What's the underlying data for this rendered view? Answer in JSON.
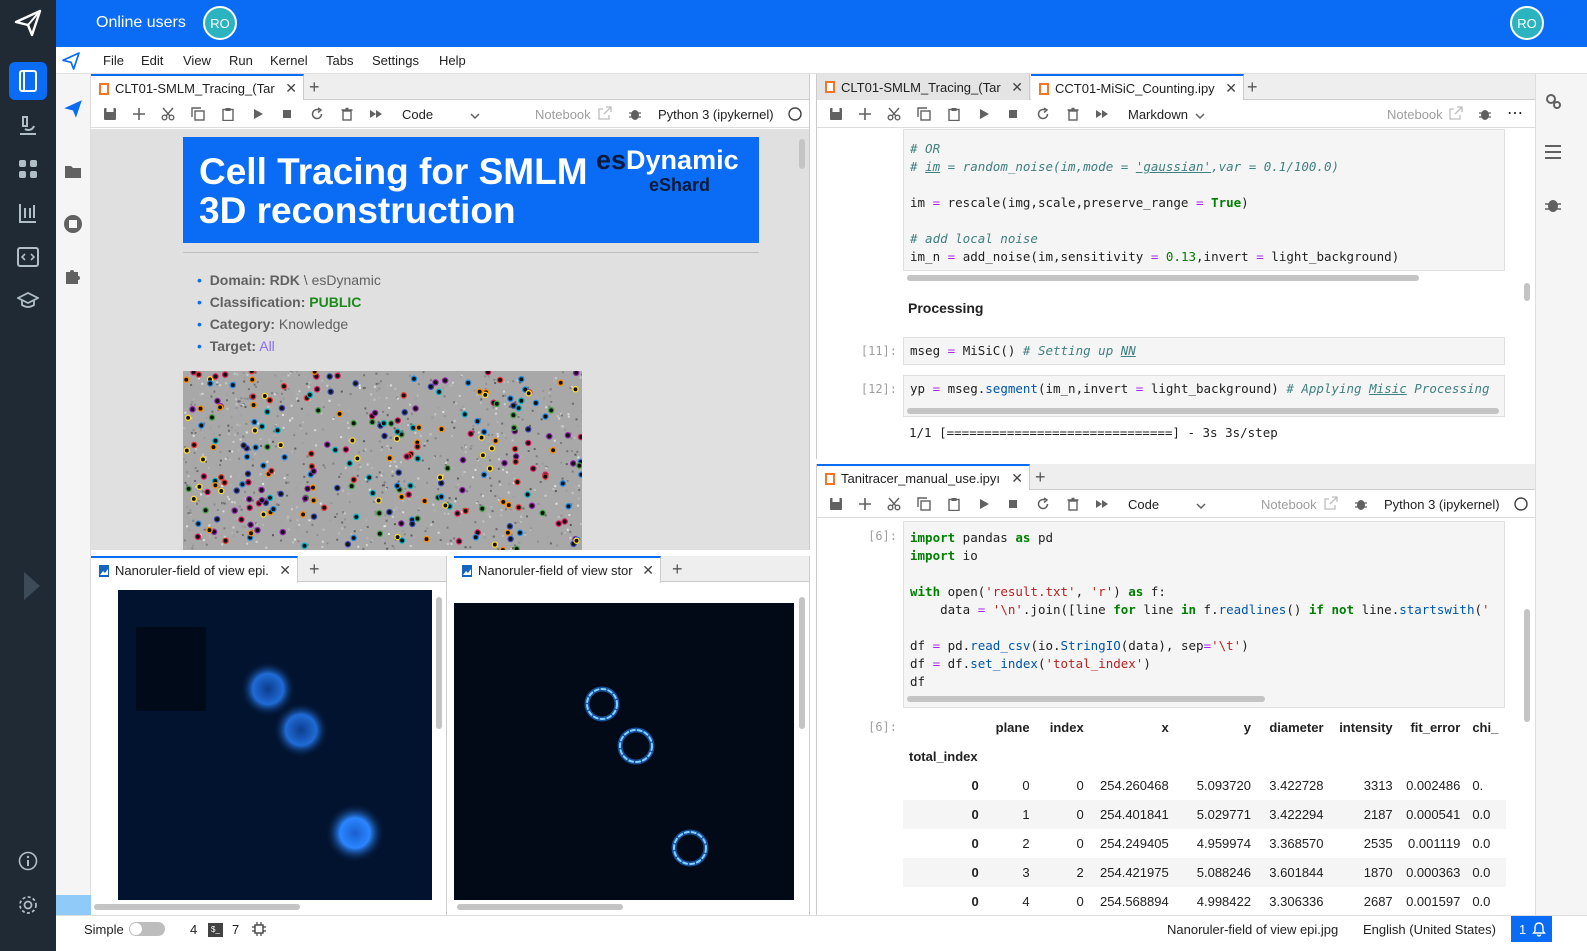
{
  "topbar": {
    "title": "Online users",
    "avatar_left": "RO",
    "avatar_right": "RO"
  },
  "menu": [
    "File",
    "Edit",
    "View",
    "Run",
    "Kernel",
    "Tabs",
    "Settings",
    "Help"
  ],
  "panel_tl": {
    "tab": "CLT01-SMLM_Tracing_(Tar",
    "cell_type": "Code",
    "notebook_label": "Notebook",
    "kernel": "Python 3 (ipykernel)",
    "banner_title_1": "Cell Tracing for SMLM",
    "banner_title_2": "3D reconstruction",
    "logo_es": "es",
    "logo_dynamic": "Dynamic",
    "logo_eshard": "eShard",
    "bullets": [
      {
        "label": "Domain:",
        "value_bold": "RDK",
        "value": " \\ esDynamic"
      },
      {
        "label": "Classification:",
        "value_bold": "PUBLIC",
        "value": ""
      },
      {
        "label": "Category:",
        "value_bold": "",
        "value": " Knowledge"
      },
      {
        "label": "Target:",
        "value_bold": "",
        "value": " All"
      }
    ]
  },
  "panel_bl1": {
    "tab": "Nanoruler-field of view epi."
  },
  "panel_bl2": {
    "tab": "Nanoruler-field of view stor"
  },
  "panel_tr": {
    "tab1": "CLT01-SMLM_Tracing_(Tar",
    "tab2": "CCT01-MiSiC_Counting.ipy",
    "cell_type": "Markdown",
    "notebook_label": "Notebook",
    "heading": "Processing",
    "prompt_11": "[11]:",
    "prompt_12": "[12]:",
    "progress_output": "1/1 [==============================] - 3s 3s/step"
  },
  "panel_br": {
    "tab": "Tanitracer_manual_use.ipyı",
    "cell_type": "Code",
    "notebook_label": "Notebook",
    "kernel": "Python 3 (ipykernel)",
    "prompt_in": "[6]:",
    "prompt_out": "[6]:",
    "table": {
      "columns": [
        "plane",
        "index",
        "x",
        "y",
        "diameter",
        "intensity",
        "fit_error",
        "chi_"
      ],
      "index_name": "total_index",
      "rows": [
        [
          "0",
          "0",
          "0",
          "254.260468",
          "5.093720",
          "3.422728",
          "3313",
          "0.002486",
          "0."
        ],
        [
          "0",
          "1",
          "0",
          "254.401841",
          "5.029771",
          "3.422294",
          "2187",
          "0.000541",
          "0.0"
        ],
        [
          "0",
          "2",
          "0",
          "254.249405",
          "4.959974",
          "3.368570",
          "2535",
          "0.001119",
          "0.0"
        ],
        [
          "0",
          "3",
          "2",
          "254.421975",
          "5.088246",
          "3.601844",
          "1870",
          "0.000363",
          "0.0"
        ],
        [
          "0",
          "4",
          "0",
          "254.568894",
          "4.998422",
          "3.306336",
          "2687",
          "0.001597",
          "0.0"
        ]
      ]
    }
  },
  "statusbar": {
    "mode": "Simple",
    "count_a": "4",
    "count_b": "7",
    "file": "Nanoruler-field of view epi.jpg",
    "language": "English (United States)",
    "notif": "1"
  }
}
